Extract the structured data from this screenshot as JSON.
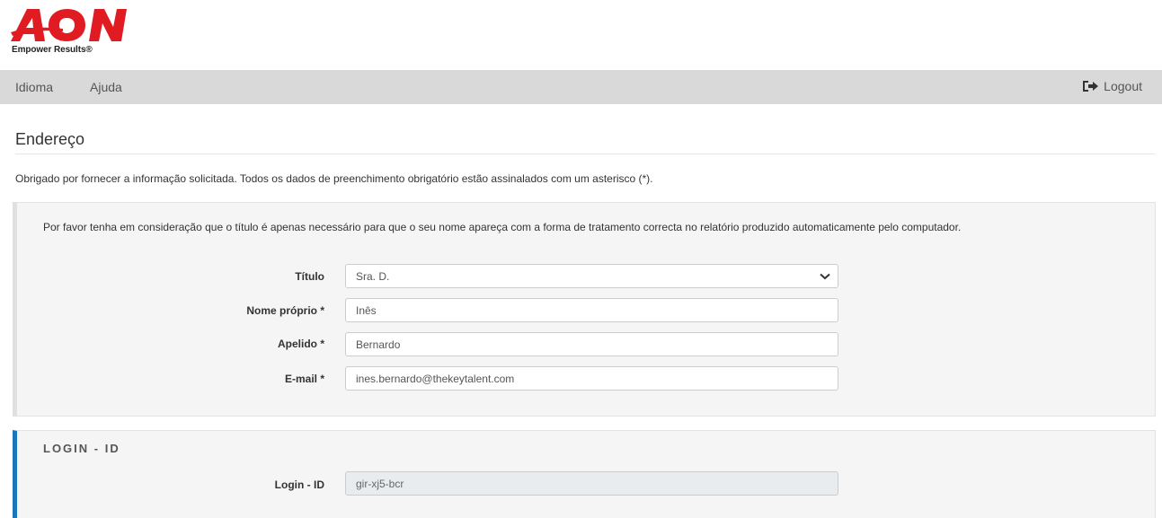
{
  "brand": {
    "logo_text": "AON",
    "tagline": "Empower Results®",
    "color": "#e11b22"
  },
  "navbar": {
    "items": [
      {
        "label": "Idioma"
      },
      {
        "label": "Ajuda"
      }
    ],
    "logout_label": "Logout",
    "logout_icon": "sign-out-icon"
  },
  "page": {
    "title": "Endereço",
    "intro": "Obrigado por fornecer a informação solicitada. Todos os dados de preenchimento obrigatório estão assinalados com um asterisco (*)."
  },
  "address_panel": {
    "note": "Por favor tenha em consideração que o título é apenas necessário para que o seu nome apareça com a forma de tratamento correcta no relatório produzido automaticamente pelo computador.",
    "fields": {
      "title": {
        "label": "Título",
        "value": "Sra. D."
      },
      "first_name": {
        "label": "Nome próprio *",
        "value": "Inês"
      },
      "last_name": {
        "label": "Apelido *",
        "value": "Bernardo"
      },
      "email": {
        "label": "E-mail *",
        "value": "ines.bernardo@thekeytalent.com"
      }
    }
  },
  "login_panel": {
    "heading": "LOGIN - ID",
    "field": {
      "label": "Login - ID",
      "value": "gir-xj5-bcr"
    },
    "accent_color": "#1b75bb"
  }
}
